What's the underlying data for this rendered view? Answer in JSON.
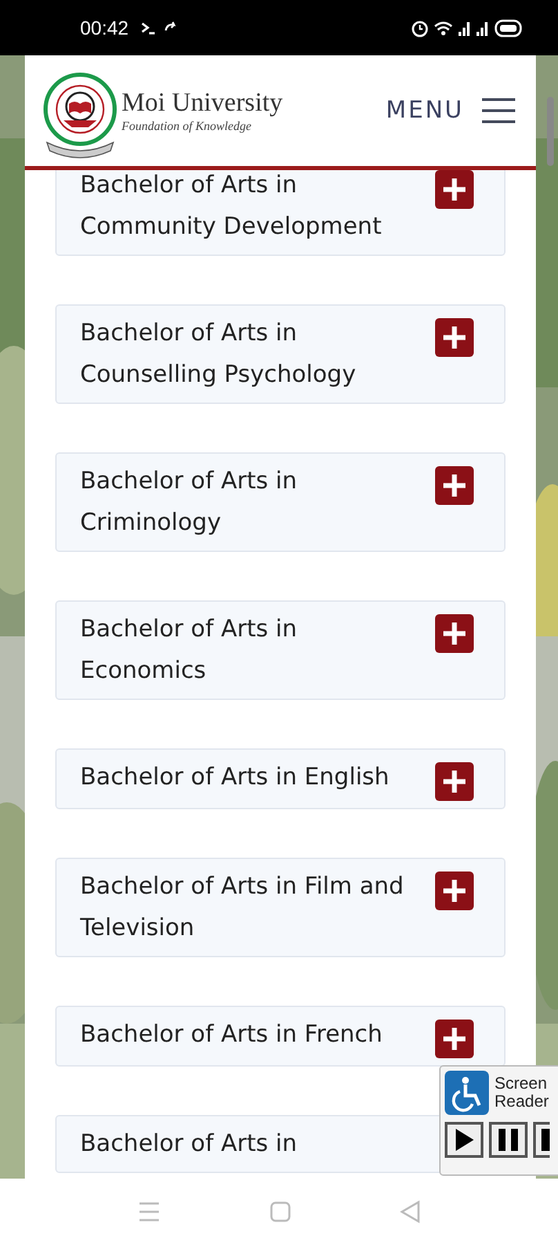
{
  "status_bar": {
    "time": "00:42"
  },
  "header": {
    "title": "Moi University",
    "tagline": "Foundation of Knowledge",
    "menu_label": "MENU"
  },
  "programmes": [
    {
      "title": "Bachelor of Arts in Community Development",
      "expanded": false
    },
    {
      "title": "Bachelor of Arts in Counselling Psychology",
      "expanded": false
    },
    {
      "title": "Bachelor of Arts in Criminology",
      "expanded": false
    },
    {
      "title": "Bachelor of Arts in Economics",
      "expanded": false
    },
    {
      "title": "Bachelor of Arts in English",
      "expanded": false
    },
    {
      "title": "Bachelor of Arts in Film and Television",
      "expanded": false
    },
    {
      "title": "Bachelor of Arts in French",
      "expanded": false
    },
    {
      "title": "Bachelor of Arts in"
    }
  ],
  "screen_reader": {
    "label_line_1": "Screen",
    "label_line_2": "Reader"
  }
}
